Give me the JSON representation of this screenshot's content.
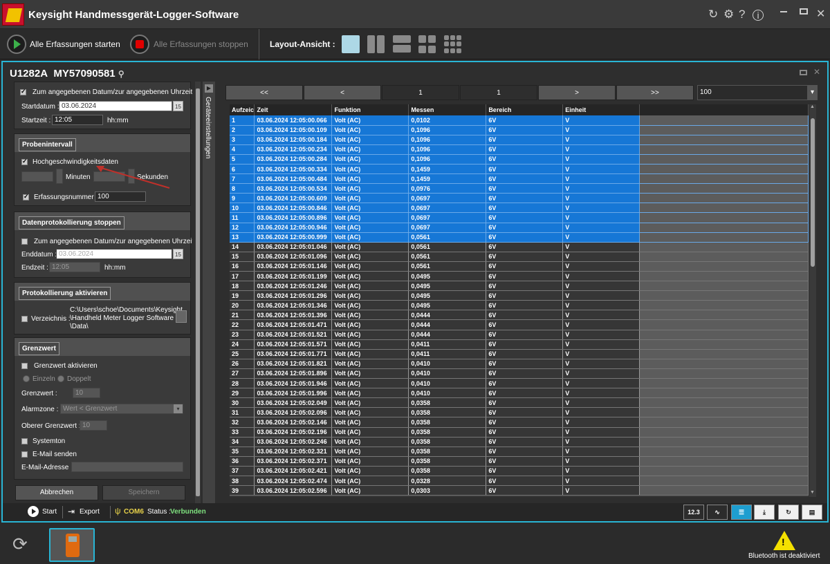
{
  "window": {
    "title": "Keysight Handmessgerät-Logger-Software"
  },
  "toolbar": {
    "start_all": "Alle Erfassungen starten",
    "stop_all": "Alle Erfassungen stoppen",
    "layout_label": "Layout-Ansicht :"
  },
  "device": {
    "model": "U1282A",
    "serial": "MY57090581"
  },
  "settings": {
    "start": {
      "checkbox_label": "Zum angegebenen Datum/zur angegebenen Uhrzeit",
      "date_label": "Startdatum :",
      "date_value": "03.06.2024",
      "time_label": "Startzeit :",
      "time_value": "12:05",
      "time_unit": "hh:mm"
    },
    "interval": {
      "button": "Probenintervall",
      "highspeed_label": "Hochgeschwindigkeitsdaten",
      "minutes_label": "Minuten",
      "seconds_label": "Sekunden",
      "count_label": "Erfassungsnummer :",
      "count_value": "100"
    },
    "stop": {
      "button": "Datenprotokollierung stoppen",
      "checkbox_label": "Zum angegebenen Datum/zur angegebenen Uhrzeit",
      "end_date_label": "Enddatum :",
      "end_date_value": "03.06.2024",
      "end_time_label": "Endzeit :",
      "end_time_value": "12:05",
      "time_unit": "hh:mm"
    },
    "logging": {
      "button": "Protokollierung aktivieren",
      "dir_label": "Verzeichnis :",
      "dir_line1": "C:\\Users\\schoe\\Documents\\Keysight",
      "dir_line2": "\\Handheld Meter Logger Software",
      "dir_line3": "\\Data\\"
    },
    "limit": {
      "button": "Grenzwert",
      "enable_label": "Grenzwert aktivieren",
      "single_label": "Einzeln",
      "double_label": "Doppelt",
      "limit_label": "Grenzwert :",
      "limit_value": "10",
      "alarm_label": "Alarmzone :",
      "alarm_value": "Wert < Grenzwert",
      "upper_label": "Oberer Grenzwert :",
      "upper_value": "10",
      "systone_label": "Systemton",
      "email_label": "E-Mail senden",
      "email_addr_label": "E-Mail-Adresse :"
    },
    "cancel": "Abbrechen",
    "save": "Speichern",
    "side_tab": "Geräteeinstellungen"
  },
  "pager": {
    "first": "<<",
    "prev": "<",
    "current": "1",
    "total": "1",
    "next": ">",
    "last": ">>",
    "page_size": "100"
  },
  "table": {
    "headers": [
      "Aufzeic",
      "Zeit",
      "Funktion",
      "Messen",
      "Bereich",
      "Einheit"
    ],
    "selected_rows": 13,
    "rows": [
      [
        "1",
        "03.06.2024 12:05:00.066",
        "Volt (AC)",
        "0,0102",
        "6V",
        "V"
      ],
      [
        "2",
        "03.06.2024 12:05:00.109",
        "Volt (AC)",
        "0,1096",
        "6V",
        "V"
      ],
      [
        "3",
        "03.06.2024 12:05:00.184",
        "Volt (AC)",
        "0,1096",
        "6V",
        "V"
      ],
      [
        "4",
        "03.06.2024 12:05:00.234",
        "Volt (AC)",
        "0,1096",
        "6V",
        "V"
      ],
      [
        "5",
        "03.06.2024 12:05:00.284",
        "Volt (AC)",
        "0,1096",
        "6V",
        "V"
      ],
      [
        "6",
        "03.06.2024 12:05:00.334",
        "Volt (AC)",
        "0,1459",
        "6V",
        "V"
      ],
      [
        "7",
        "03.06.2024 12:05:00.484",
        "Volt (AC)",
        "0,1459",
        "6V",
        "V"
      ],
      [
        "8",
        "03.06.2024 12:05:00.534",
        "Volt (AC)",
        "0,0976",
        "6V",
        "V"
      ],
      [
        "9",
        "03.06.2024 12:05:00.609",
        "Volt (AC)",
        "0,0697",
        "6V",
        "V"
      ],
      [
        "10",
        "03.06.2024 12:05:00.846",
        "Volt (AC)",
        "0,0697",
        "6V",
        "V"
      ],
      [
        "11",
        "03.06.2024 12:05:00.896",
        "Volt (AC)",
        "0,0697",
        "6V",
        "V"
      ],
      [
        "12",
        "03.06.2024 12:05:00.946",
        "Volt (AC)",
        "0,0697",
        "6V",
        "V"
      ],
      [
        "13",
        "03.06.2024 12:05:00.999",
        "Volt (AC)",
        "0,0561",
        "6V",
        "V"
      ],
      [
        "14",
        "03.06.2024 12:05:01.046",
        "Volt (AC)",
        "0,0561",
        "6V",
        "V"
      ],
      [
        "15",
        "03.06.2024 12:05:01.096",
        "Volt (AC)",
        "0,0561",
        "6V",
        "V"
      ],
      [
        "16",
        "03.06.2024 12:05:01.146",
        "Volt (AC)",
        "0,0561",
        "6V",
        "V"
      ],
      [
        "17",
        "03.06.2024 12:05:01.199",
        "Volt (AC)",
        "0,0495",
        "6V",
        "V"
      ],
      [
        "18",
        "03.06.2024 12:05:01.246",
        "Volt (AC)",
        "0,0495",
        "6V",
        "V"
      ],
      [
        "19",
        "03.06.2024 12:05:01.296",
        "Volt (AC)",
        "0,0495",
        "6V",
        "V"
      ],
      [
        "20",
        "03.06.2024 12:05:01.346",
        "Volt (AC)",
        "0,0495",
        "6V",
        "V"
      ],
      [
        "21",
        "03.06.2024 12:05:01.396",
        "Volt (AC)",
        "0,0444",
        "6V",
        "V"
      ],
      [
        "22",
        "03.06.2024 12:05:01.471",
        "Volt (AC)",
        "0,0444",
        "6V",
        "V"
      ],
      [
        "23",
        "03.06.2024 12:05:01.521",
        "Volt (AC)",
        "0,0444",
        "6V",
        "V"
      ],
      [
        "24",
        "03.06.2024 12:05:01.571",
        "Volt (AC)",
        "0,0411",
        "6V",
        "V"
      ],
      [
        "25",
        "03.06.2024 12:05:01.771",
        "Volt (AC)",
        "0,0411",
        "6V",
        "V"
      ],
      [
        "26",
        "03.06.2024 12:05:01.821",
        "Volt (AC)",
        "0,0410",
        "6V",
        "V"
      ],
      [
        "27",
        "03.06.2024 12:05:01.896",
        "Volt (AC)",
        "0,0410",
        "6V",
        "V"
      ],
      [
        "28",
        "03.06.2024 12:05:01.946",
        "Volt (AC)",
        "0,0410",
        "6V",
        "V"
      ],
      [
        "29",
        "03.06.2024 12:05:01.996",
        "Volt (AC)",
        "0,0410",
        "6V",
        "V"
      ],
      [
        "30",
        "03.06.2024 12:05:02.049",
        "Volt (AC)",
        "0,0358",
        "6V",
        "V"
      ],
      [
        "31",
        "03.06.2024 12:05:02.096",
        "Volt (AC)",
        "0,0358",
        "6V",
        "V"
      ],
      [
        "32",
        "03.06.2024 12:05:02.146",
        "Volt (AC)",
        "0,0358",
        "6V",
        "V"
      ],
      [
        "33",
        "03.06.2024 12:05:02.196",
        "Volt (AC)",
        "0,0358",
        "6V",
        "V"
      ],
      [
        "34",
        "03.06.2024 12:05:02.246",
        "Volt (AC)",
        "0,0358",
        "6V",
        "V"
      ],
      [
        "35",
        "03.06.2024 12:05:02.321",
        "Volt (AC)",
        "0,0358",
        "6V",
        "V"
      ],
      [
        "36",
        "03.06.2024 12:05:02.371",
        "Volt (AC)",
        "0,0358",
        "6V",
        "V"
      ],
      [
        "37",
        "03.06.2024 12:05:02.421",
        "Volt (AC)",
        "0,0358",
        "6V",
        "V"
      ],
      [
        "38",
        "03.06.2024 12:05:02.474",
        "Volt (AC)",
        "0,0328",
        "6V",
        "V"
      ],
      [
        "39",
        "03.06.2024 12:05:02.596",
        "Volt (AC)",
        "0,0303",
        "6V",
        "V"
      ]
    ]
  },
  "statusbar": {
    "start": "Start",
    "export": "Export",
    "port": "COM6",
    "status_label": "Status :",
    "status_value": "Verbunden",
    "view_numeric": "12.3"
  },
  "dock": {
    "bluetooth_status": "Bluetooth ist deaktiviert"
  },
  "colors": {
    "accent": "#29b6d6",
    "selection": "#1677d6",
    "status_ok": "#7ee07e",
    "warning": "#f4e000"
  }
}
